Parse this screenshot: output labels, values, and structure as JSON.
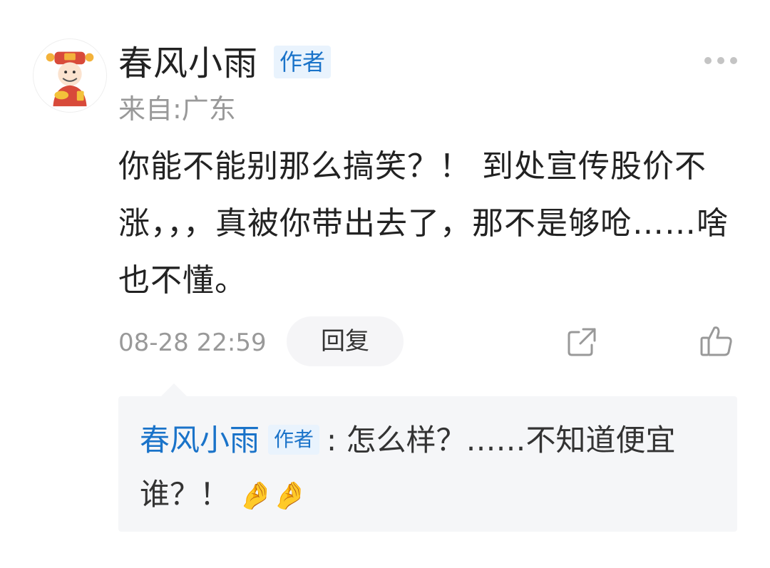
{
  "comment": {
    "user": {
      "name": "春风小雨",
      "badge": "作者",
      "location": "来自:广东",
      "avatar_icon": "god-of-wealth-avatar"
    },
    "text": "你能不能别那么搞笑？！ 到处宣传股价不涨，，，真被你带出去了，那不是够呛……啥也不懂。",
    "timestamp": "08-28 22:59",
    "reply_label": "回复",
    "more_icon": "more-dots-icon",
    "share_icon": "share-icon",
    "like_icon": "thumbs-up-icon"
  },
  "reply": {
    "user": "春风小雨",
    "badge": "作者",
    "separator": ":",
    "text": "怎么样？……不知道便宜谁？！",
    "emoji": "🤌🤌"
  },
  "colors": {
    "accent": "#1a73c9",
    "badge_bg": "#e9f3fd",
    "muted_text": "#999999",
    "reply_bg": "#f5f6f8"
  }
}
